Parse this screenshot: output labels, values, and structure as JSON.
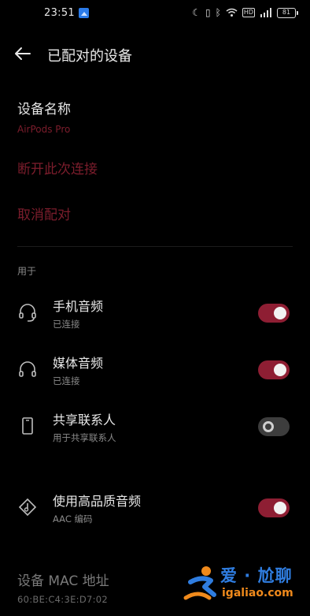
{
  "status_bar": {
    "time": "23:51",
    "icons": [
      "moon-icon",
      "vibrate-icon",
      "bluetooth-icon",
      "wifi-icon",
      "hd-icon",
      "signal-icon"
    ],
    "battery": "81"
  },
  "app_bar": {
    "title": "已配对的设备"
  },
  "device": {
    "name_label": "设备名称",
    "name_value": "AirPods Pro"
  },
  "actions": {
    "disconnect": "断开此次连接",
    "unpair": "取消配对"
  },
  "usage": {
    "header": "用于",
    "items": [
      {
        "title": "手机音频",
        "subtitle": "已连接",
        "icon": "headset-mic-icon",
        "enabled": true
      },
      {
        "title": "媒体音频",
        "subtitle": "已连接",
        "icon": "headphones-icon",
        "enabled": true
      },
      {
        "title": "共享联系人",
        "subtitle": "用于共享联系人",
        "icon": "phone-icon",
        "enabled": false
      }
    ],
    "hq": {
      "title": "使用高品质音频",
      "subtitle": "AAC 编码",
      "icon": "hq-audio-icon",
      "enabled": true
    }
  },
  "mac": {
    "label": "设备 MAC 地址",
    "value": "60:BE:C4:3E:D7:02"
  },
  "watermark": {
    "brand": "爱 · 尬聊",
    "url": "igaliao.com"
  },
  "colors": {
    "accent": "#8e1e33",
    "accent_text": "#7c1d2c",
    "background": "#000000"
  }
}
